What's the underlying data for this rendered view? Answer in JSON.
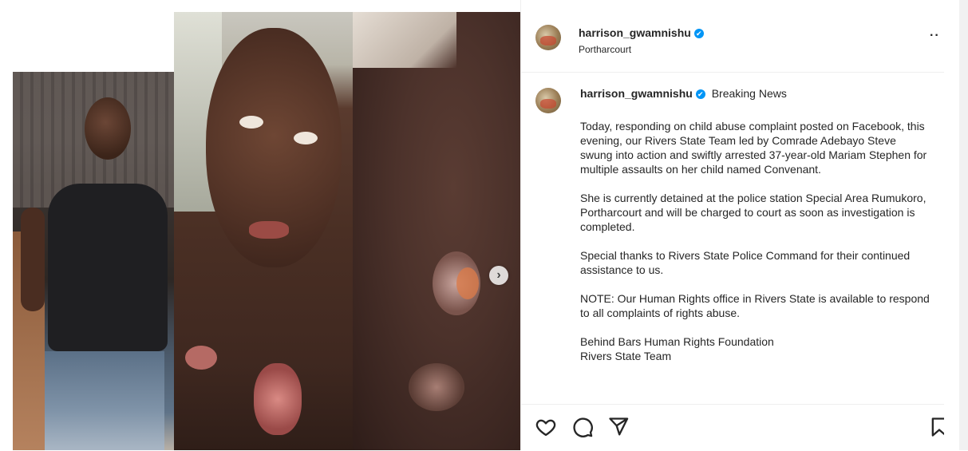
{
  "post": {
    "username": "harrison_gwamnishu",
    "location": "Portharcourt",
    "verified_badge": "✔",
    "more_label": "··",
    "caption_tag": "Breaking News",
    "caption_paragraphs": [
      "Today, responding on child abuse complaint posted on Facebook, this evening, our Rivers State Team led by Comrade Adebayo Steve swung into action and swiftly arrested 37-year-old Mariam Stephen for multiple assaults on her child named Convenant.",
      "She is currently detained at the police station Special Area Rumukoro, Portharcourt and will be charged to court as soon as investigation is completed.",
      "Special thanks to Rivers State Police Command for their continued assistance to us.",
      "NOTE: Our Human Rights office in Rivers State is available to respond to all complaints of rights abuse."
    ],
    "signature_line1": "Behind Bars Human Rights Foundation",
    "signature_line2": "Rivers State Team"
  },
  "media": {
    "next_glyph": "›"
  },
  "icons": {
    "like": "heart-icon",
    "comment": "comment-icon",
    "share": "share-icon",
    "save": "bookmark-icon"
  },
  "colors": {
    "verified": "#0095f6",
    "text": "#262626",
    "divider": "#efefef"
  }
}
